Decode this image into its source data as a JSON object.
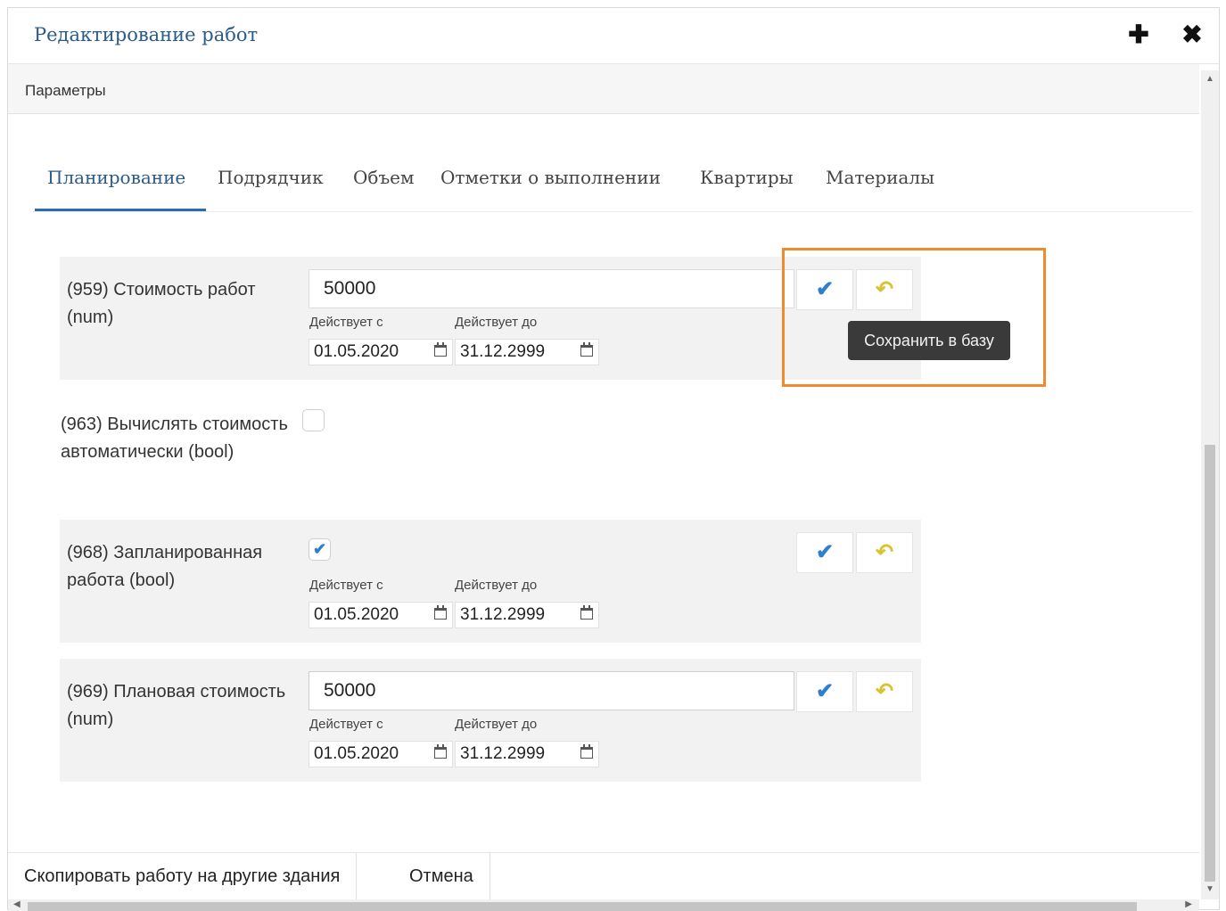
{
  "window": {
    "title": "Редактирование работ",
    "add_icon": "plus-icon",
    "close_icon": "close-icon",
    "add_glyph": "✚",
    "close_glyph": "✖"
  },
  "section": {
    "label": "Параметры"
  },
  "tabs": [
    {
      "label": "Планирование",
      "active": true
    },
    {
      "label": "Подрядчик"
    },
    {
      "label": "Объем"
    },
    {
      "label": "Отметки о выполнении"
    },
    {
      "label": "Квартиры"
    },
    {
      "label": "Материалы"
    }
  ],
  "params": [
    {
      "label": "(959) Стоимость работ (num)",
      "value": "50000",
      "from_label": "Действует с",
      "to_label": "Действует до",
      "from_date": "01.05.2020",
      "to_date": "31.12.2999"
    },
    {
      "label": "(963) Вычислять стоимость автоматически (bool)",
      "checked": false
    },
    {
      "label": "(968) Запланированная работа (bool)",
      "checked": true,
      "check_glyph": "✔",
      "from_label": "Действует с",
      "to_label": "Действует до",
      "from_date": "01.05.2020",
      "to_date": "31.12.2999"
    },
    {
      "label": "(969) Плановая стоимость (num)",
      "value": "50000",
      "from_label": "Действует с",
      "to_label": "Действует до",
      "from_date": "01.05.2020",
      "to_date": "31.12.2999"
    }
  ],
  "actions": {
    "ok_glyph": "✔",
    "undo_glyph": "↶",
    "ok_icon": "checkmark-icon",
    "undo_icon": "undo-icon"
  },
  "tooltip": {
    "text": "Сохранить в базу"
  },
  "footer": {
    "copy_label": "Скопировать работу на другие здания",
    "cancel_label": "Отмена"
  },
  "colors": {
    "accent": "#2b5b8a",
    "check": "#2f7fd1",
    "undo": "#d9c232",
    "highlight": "#f08a2e"
  }
}
